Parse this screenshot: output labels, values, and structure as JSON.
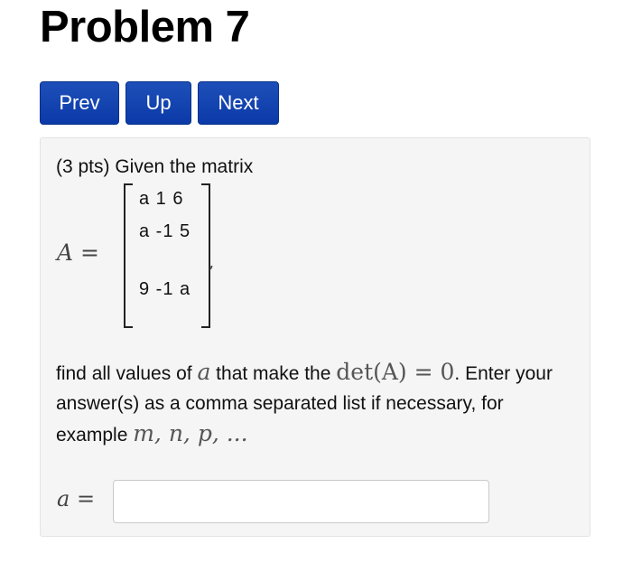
{
  "page": {
    "title": "Problem 7"
  },
  "nav": {
    "prev_label": "Prev",
    "up_label": "Up",
    "next_label": "Next"
  },
  "problem": {
    "intro": "(3 pts) Given the matrix",
    "matrix_name": "A",
    "equals": "=",
    "matrix_rows": [
      "a 1 6",
      "a -1 5",
      "9 -1 a"
    ],
    "matrix_trailing": ",",
    "text_part1": "find all values of ",
    "var_a": "a",
    "text_part2": " that make the ",
    "det_expr": "det(A) = 0",
    "text_part3": ". Enter your answer(s) as a comma separated list if necessary, for example ",
    "example_list": "m, n, p, ..."
  },
  "answer": {
    "label_var": "a",
    "label_eq": " =",
    "value": "",
    "placeholder": ""
  },
  "colors": {
    "button_bg": "#0b3aa8",
    "panel_bg": "#f5f5f5"
  }
}
